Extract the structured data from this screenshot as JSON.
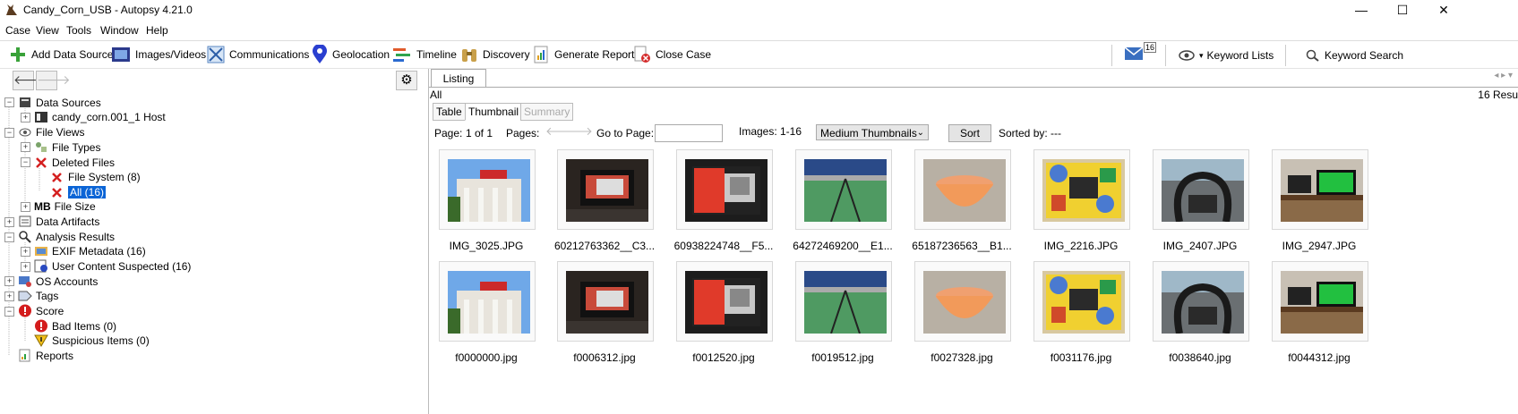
{
  "window": {
    "title": "Candy_Corn_USB - Autopsy 4.21.0",
    "minimize": "—",
    "maximize": "☐",
    "close": "✕"
  },
  "menu": [
    "Case",
    "View",
    "Tools",
    "Window",
    "Help"
  ],
  "toolbar": {
    "add_data_source": "Add Data Source",
    "images_videos": "Images/Videos",
    "communications": "Communications",
    "geolocation": "Geolocation",
    "timeline": "Timeline",
    "discovery": "Discovery",
    "generate_report": "Generate Report",
    "close_case": "Close Case",
    "mail_count": "16",
    "keyword_lists": "Keyword Lists",
    "keyword_search": "Keyword Search"
  },
  "tree": [
    {
      "label": "Data Sources",
      "icon": "data-sources-icon"
    },
    {
      "label": "candy_corn.001_1 Host",
      "icon": "host-icon"
    },
    {
      "label": "File Views",
      "icon": "file-views-icon"
    },
    {
      "label": "File Types",
      "icon": "file-types-icon"
    },
    {
      "label": "Deleted Files",
      "icon": "deleted-files-icon"
    },
    {
      "label": "File System (8)",
      "icon": "deleted-file-icon"
    },
    {
      "label": "All (16)",
      "icon": "deleted-file-icon"
    },
    {
      "label": "File Size",
      "icon": "file-size-icon"
    },
    {
      "label": "Data Artifacts",
      "icon": "data-artifacts-icon"
    },
    {
      "label": "Analysis Results",
      "icon": "analysis-results-icon"
    },
    {
      "label": "EXIF Metadata (16)",
      "icon": "exif-icon"
    },
    {
      "label": "User Content Suspected (16)",
      "icon": "user-content-icon"
    },
    {
      "label": "OS Accounts",
      "icon": "os-accounts-icon"
    },
    {
      "label": "Tags",
      "icon": "tags-icon"
    },
    {
      "label": "Score",
      "icon": "score-icon"
    },
    {
      "label": "Bad Items (0)",
      "icon": "bad-items-icon"
    },
    {
      "label": "Suspicious Items (0)",
      "icon": "suspicious-items-icon"
    },
    {
      "label": "Reports",
      "icon": "reports-icon"
    }
  ],
  "tree_mb_label": "MB",
  "listing": {
    "tab": "Listing",
    "scope": "All",
    "results": "16  Resu",
    "subtabs": [
      "Table",
      "Thumbnail",
      "Summary"
    ],
    "page_label": "Page:",
    "page_value": "1 of 1",
    "pages_label": "Pages:",
    "goto_label": "Go to Page:",
    "images_label": "Images:",
    "images_range": "1-16",
    "thumb_size": "Medium Thumbnails",
    "sort_button": "Sort",
    "sorted_by": "Sorted by: ---"
  },
  "thumbnails": [
    {
      "name": "IMG_3025.JPG",
      "scene": "building"
    },
    {
      "name": "60212763362__C3...",
      "scene": "dashboard"
    },
    {
      "name": "60938224748__F5...",
      "scene": "monitor"
    },
    {
      "name": "64272469200__E1...",
      "scene": "court"
    },
    {
      "name": "65187236563__B1...",
      "scene": "bowl"
    },
    {
      "name": "IMG_2216.JPG",
      "scene": "poster"
    },
    {
      "name": "IMG_2407.JPG",
      "scene": "car"
    },
    {
      "name": "IMG_2947.JPG",
      "scene": "desk"
    },
    {
      "name": "f0000000.jpg",
      "scene": "building"
    },
    {
      "name": "f0006312.jpg",
      "scene": "dashboard"
    },
    {
      "name": "f0012520.jpg",
      "scene": "monitor"
    },
    {
      "name": "f0019512.jpg",
      "scene": "court"
    },
    {
      "name": "f0027328.jpg",
      "scene": "bowl"
    },
    {
      "name": "f0031176.jpg",
      "scene": "poster"
    },
    {
      "name": "f0038640.jpg",
      "scene": "car"
    },
    {
      "name": "f0044312.jpg",
      "scene": "desk"
    }
  ]
}
